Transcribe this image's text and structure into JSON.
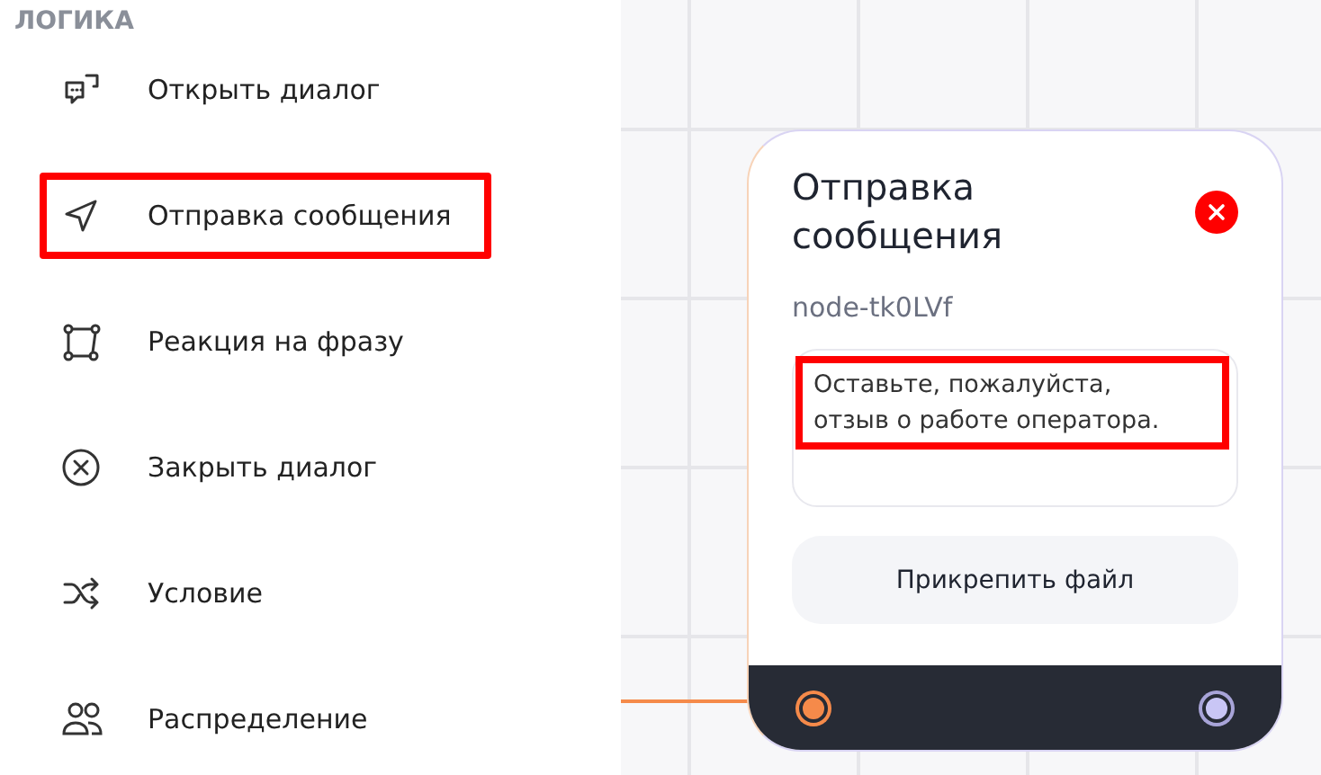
{
  "sidebar": {
    "section_title": "ЛОГИКА",
    "items": [
      {
        "kind": "chat",
        "label": "Открыть диалог",
        "highlighted": false
      },
      {
        "kind": "send",
        "label": "Отправка сообщения",
        "highlighted": true
      },
      {
        "kind": "reaction",
        "label": "Реакция на фразу",
        "highlighted": false
      },
      {
        "kind": "close",
        "label": "Закрыть диалог",
        "highlighted": false
      },
      {
        "kind": "condition",
        "label": "Условие",
        "highlighted": false
      },
      {
        "kind": "distribution",
        "label": "Распределение",
        "highlighted": false
      }
    ]
  },
  "node": {
    "title": "Отправка сообщения",
    "id": "node-tk0LVf",
    "message": "Оставьте, пожалуйста, отзыв о работе оператора.",
    "message_highlighted": true,
    "attach_button": "Прикрепить файл",
    "input_connected": true
  }
}
